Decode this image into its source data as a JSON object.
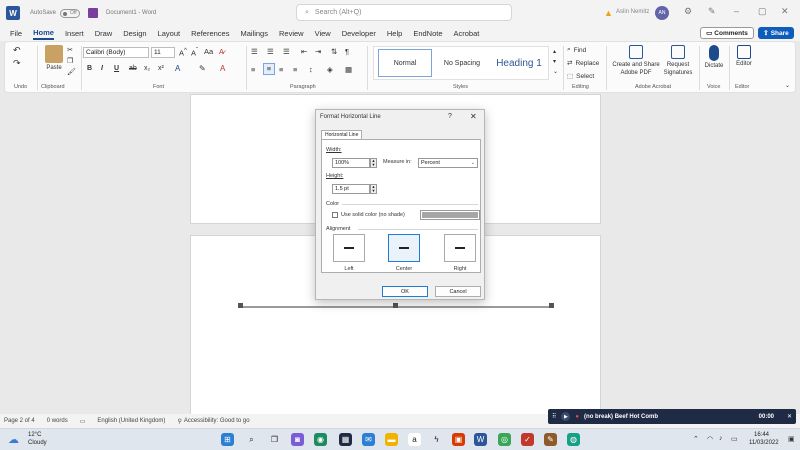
{
  "titlebar": {
    "autosave_label": "AutoSave",
    "autosave_state": "Off",
    "doc_title": "Document1 - Word",
    "search_placeholder": "Search (Alt+Q)",
    "user_name": "Aslin Nemitz",
    "user_initials": "AN"
  },
  "tabs": [
    "File",
    "Home",
    "Insert",
    "Draw",
    "Design",
    "Layout",
    "References",
    "Mailings",
    "Review",
    "View",
    "Developer",
    "Help",
    "EndNote",
    "Acrobat"
  ],
  "active_tab": "Home",
  "actions": {
    "comments": "Comments",
    "share": "Share"
  },
  "ribbon": {
    "groups": {
      "undo": "Undo",
      "clipboard": "Clipboard",
      "font": "Font",
      "paragraph": "Paragraph",
      "styles": "Styles",
      "editing": "Editing",
      "adobe": "Adobe Acrobat",
      "voice": "Voice",
      "editor": "Editor"
    },
    "paste_label": "Paste",
    "font_name": "Calibri (Body)",
    "font_size": "11",
    "format_buttons": [
      "B",
      "I",
      "U",
      "ab",
      "x₂",
      "x²"
    ],
    "styles": [
      "Normal",
      "No Spacing",
      "Heading 1"
    ],
    "editing": {
      "find": "Find",
      "replace": "Replace",
      "select": "Select"
    },
    "adobe_create": "Create and Share Adobe PDF",
    "adobe_request": "Request Signatures",
    "dictate": "Dictate",
    "editor": "Editor"
  },
  "dialog": {
    "title": "Format Horizontal Line",
    "help": "?",
    "close": "✕",
    "tab": "Horizontal Line",
    "width_label": "Width:",
    "width_value": "100%",
    "measure_label": "Measure in:",
    "measure_value": "Percent",
    "height_label": "Height:",
    "height_value": "1.5 pt",
    "color_label": "Color",
    "solid_color_label": "Use solid color (no shade)",
    "color_swatch": "#a6a6a6",
    "alignment_label": "Alignment",
    "align_options": [
      "Left",
      "Center",
      "Right"
    ],
    "selected_alignment": "Center",
    "ok": "OK",
    "cancel": "Cancel"
  },
  "statusbar": {
    "page": "Page 2 of 4",
    "words": "0 words",
    "language": "English (United Kingdom)",
    "accessibility": "Accessibility: Good to go"
  },
  "media": {
    "title": "(no break) Beef Hot Comb",
    "time": "00:00"
  },
  "taskbar": {
    "temp": "12°C",
    "weather": "Cloudy",
    "time": "16:44",
    "date": "11/03/2022"
  },
  "colors": {
    "accent": "#1d4a8c",
    "share": "#0f5dbb",
    "word_blue": "#2b579a",
    "selection": "#1e7bd6"
  }
}
